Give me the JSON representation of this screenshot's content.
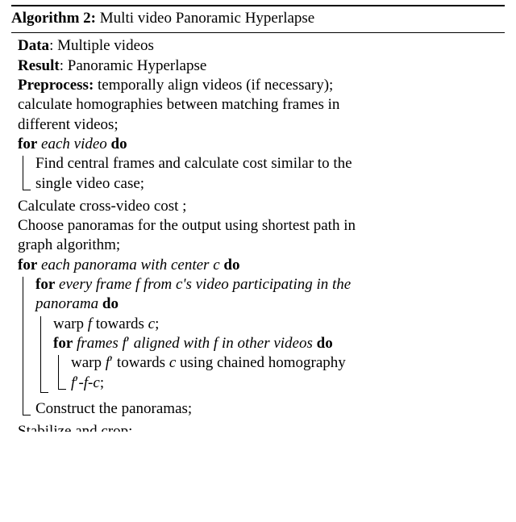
{
  "header": {
    "algo_label": "Algorithm 2:",
    "algo_title": "Multi video Panoramic Hyperlapse"
  },
  "labels": {
    "data": "Data",
    "result": "Result",
    "preprocess": "Preprocess:",
    "for": "for",
    "do": "do"
  },
  "fields": {
    "data_value": "Multiple videos",
    "result_value": "Panoramic Hyperlapse"
  },
  "pre_lines": {
    "l1": "temporally align videos (if necessary);",
    "l2": "calculate homographies between matching frames in",
    "l3": "different videos;"
  },
  "for1": {
    "cond": "each video",
    "body_l1": "Find central frames and calculate cost similar to the",
    "body_l2": "single video case;"
  },
  "after_for1": {
    "l1": "Calculate cross-video cost ;",
    "l2": "Choose panoramas for the output using shortest path in",
    "l3": "graph algorithm;"
  },
  "for2": {
    "cond_a": "each panorama with center ",
    "cond_c": "c",
    "inner": {
      "cond_a": "every frame ",
      "cond_f": "f",
      "cond_b": " from ",
      "cond_c": "c",
      "cond_d": "'s video participating in the",
      "cond_l2": "panorama",
      "body_l1a": "warp ",
      "body_l1f": "f",
      "body_l1b": " towards ",
      "body_l1c": "c",
      "body_l1d": ";",
      "inner2": {
        "cond_a": "frames ",
        "cond_fp": "f",
        "cond_prime": "′",
        "cond_b": " aligned with ",
        "cond_f": "f",
        "cond_c": " in other videos",
        "body_l1a": "warp ",
        "body_l1fp": "f",
        "body_l1prime": "′",
        "body_l1b": " towards ",
        "body_l1c": "c",
        "body_l1d": " using chained homography",
        "body_l2a": "f",
        "body_l2prime": "′",
        "body_l2dash1": "-",
        "body_l2f": "f",
        "body_l2dash2": "-",
        "body_l2c": "c",
        "body_l2end": ";"
      }
    },
    "after_inner": "Construct the panoramas;"
  },
  "cutoff": "Stabilize and crop;"
}
